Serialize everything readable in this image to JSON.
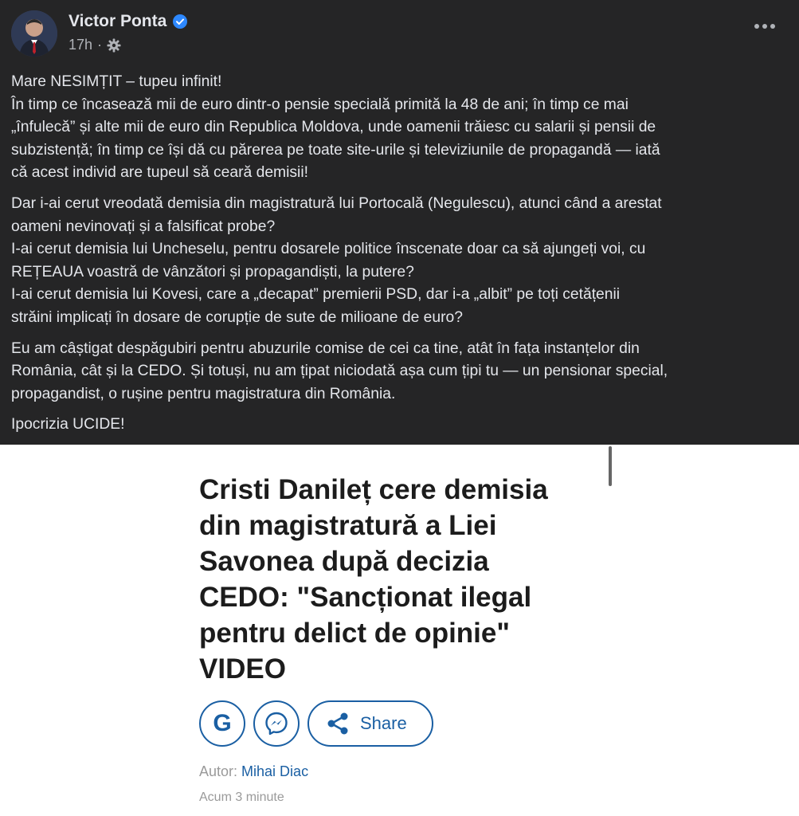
{
  "post": {
    "author": "Victor Ponta",
    "time": "17h",
    "separator": "·",
    "paragraphs": [
      [
        "Mare NESIMȚIT – tupeu infinit!",
        "În timp ce încasează mii de euro dintr-o pensie specială primită la 48 de ani; în timp ce mai",
        "„înfulecă” și alte mii de euro din Republica Moldova, unde oamenii trăiesc cu salarii și pensii de",
        "subzistență; în timp ce își dă cu părerea pe toate site-urile și televiziunile de propagandă — iată",
        "că acest individ are tupeul să ceară demisii!"
      ],
      [
        "Dar i-ai cerut vreodată demisia din magistratură lui Portocală (Negulescu), atunci când a arestat",
        "oameni nevinovați și a falsificat probe?",
        "I-ai cerut demisia lui Uncheselu, pentru dosarele politice înscenate doar ca să ajungeți voi, cu",
        "REȚEAUA voastră de vânzători și propagandiști, la putere?",
        "I-ai cerut demisia lui Kovesi, care a „decapat” premierii PSD, dar i-a „albit” pe toți cetățenii",
        "străini implicați în dosare de corupție de sute de milioane de euro?"
      ],
      [
        "Eu am câștigat despăgubiri pentru abuzurile comise de cei ca tine, atât în fața instanțelor din",
        "România, cât și la CEDO. Și totuși, nu am țipat niciodată așa cum țipi tu — un pensionar special,",
        "propagandist, o rușine pentru magistratura din România."
      ],
      [
        "Ipocrizia UCIDE!"
      ]
    ]
  },
  "article": {
    "headline_lines": [
      "Cristi Danileț cere demisia",
      "din magistratură a Liei",
      "Savonea după decizia",
      "CEDO: \"Sancționat ilegal",
      "pentru delict de opinie\"",
      "VIDEO"
    ],
    "google_letter": "G",
    "share_label": "Share",
    "author_prefix": "Autor:",
    "author_name": "Mihai Diac",
    "time": "Acum 3 minute"
  },
  "colors": {
    "post_bg": "#252526",
    "accent_blue": "#1a5fa3",
    "verified_blue": "#2d88ff"
  },
  "icons": [
    "verified-badge-icon",
    "gear-icon",
    "more-options-icon",
    "google-icon",
    "messenger-icon",
    "share-icon"
  ]
}
